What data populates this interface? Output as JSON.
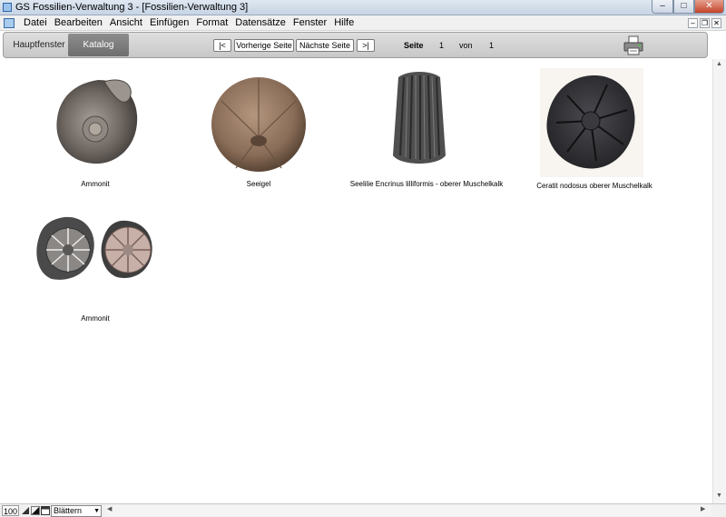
{
  "window": {
    "title": "GS Fossilien-Verwaltung 3 - [Fossilien-Verwaltung 3]",
    "min_glyph": "‒",
    "max_glyph": "□",
    "close_glyph": "✕"
  },
  "menu": {
    "items": [
      "Datei",
      "Bearbeiten",
      "Ansicht",
      "Einfügen",
      "Format",
      "Datensätze",
      "Fenster",
      "Hilfe"
    ],
    "mdi_min": "‒",
    "mdi_restore": "❐",
    "mdi_close": "✕"
  },
  "toolbar": {
    "tab_main": "Hauptfenster",
    "tab_catalog": "Katalog",
    "first": "|<",
    "prev": "Vorherige Seite",
    "next": "Nächste Seite",
    "last": ">|",
    "page_label": "Seite",
    "page_current": "1",
    "of_label": "von",
    "page_total": "1"
  },
  "catalog": {
    "items": [
      {
        "caption": "Ammonit",
        "image": "ammonite-shell-photo"
      },
      {
        "caption": "Seeigel",
        "image": "sea-urchin-photo"
      },
      {
        "caption": "Seelilie Encrinus lilliformis - oberer Muschelkalk",
        "image": "crinoid-stem-photo"
      },
      {
        "caption": "Ceratit nodosus oberer Muschelkalk",
        "image": "ceratite-photo"
      },
      {
        "caption": "Ammonit",
        "image": "ammonite-pair-photo"
      }
    ]
  },
  "status": {
    "zoom": "100",
    "mode": "Blättern",
    "mode_dropdown": "▼"
  },
  "colors": {
    "tab_active": "#7a7a7a",
    "close_button": "#c54228"
  }
}
